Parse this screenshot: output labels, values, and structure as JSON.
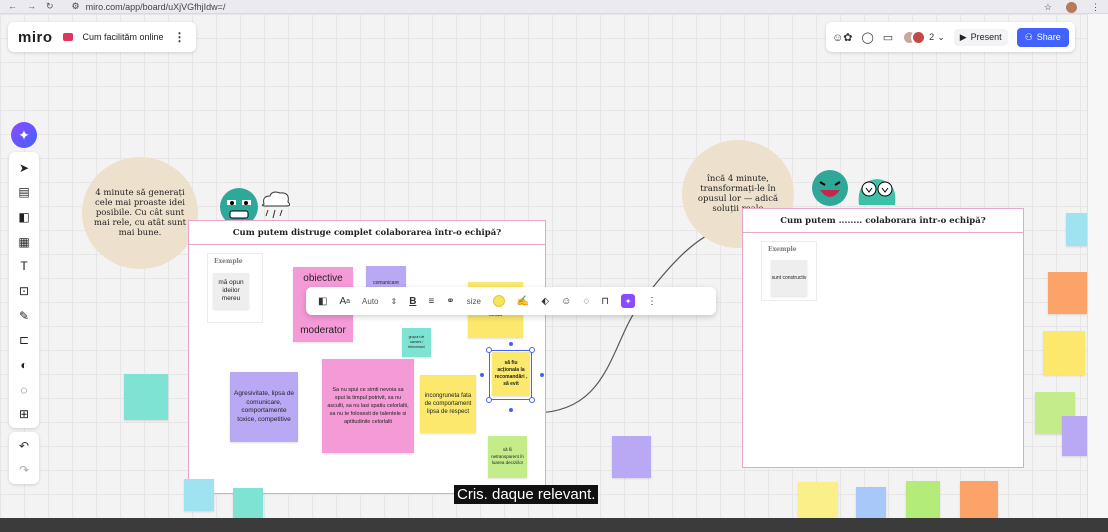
{
  "browser": {
    "url": "miro.com/app/board/uXjVGfhjIdw=/"
  },
  "header": {
    "logo": "miro",
    "board_name": "Cum facilităm online",
    "collaborator_count": "2",
    "present_label": "Present",
    "share_label": "Share",
    "accent_color": "#4262ff"
  },
  "left_circle": {
    "text": "4 minute să generați cele mai proaste idei posibile. Cu cât sunt mai rele, cu atât sunt mai bune."
  },
  "right_circle": {
    "text": "încă 4 minute, transformați-le în opusul lor — adică soluții reale"
  },
  "frame_left": {
    "title": "Cum putem distruge complet colaborarea într-o echipă?",
    "example_label": "Exemple",
    "example_note": "mă opun ideilor mereu"
  },
  "frame_right": {
    "title": "Cum putem ........ colaborara într-o echipă?",
    "example_label": "Exemple",
    "example_note": "sunt constructiv"
  },
  "notes": {
    "obiective": "obiective",
    "moderator": "moderator",
    "comunicare": "comunicare",
    "toxica": "toxica",
    "grupuri": "grupuri de oameni / teleormani",
    "agresivitate": "Agresivitate, lipsa de comunicare, comportamente toxice, competitive",
    "sa_nu_spui": "Sa nu spui ce simti nevoia sa spui la timpul potrivit, sa nu asculti, sa nu lasi spatiu celorlalti, sa nu te folosesti de talentele si aptitudinile celorlalti",
    "incongruenta": "incongruneta fata de comportament lipsa de respect",
    "selected": "să fiu acționala la recomandări , să evit",
    "transparent": "să fii netransparent în luarea deciziilor"
  },
  "floating_toolbar": {
    "font_auto": "Auto",
    "size_label": "size"
  },
  "caption": "Cris. daque relevant."
}
